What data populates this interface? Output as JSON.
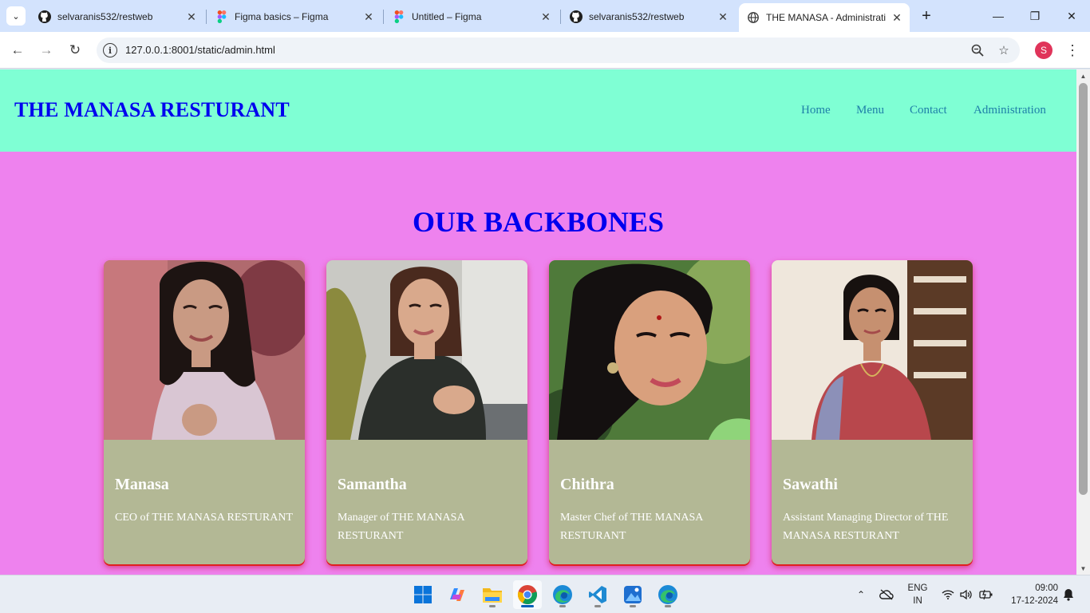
{
  "browser": {
    "tabs": [
      {
        "title": "selvaranis532/restweb",
        "icon": "github-icon"
      },
      {
        "title": "Figma basics – Figma",
        "icon": "figma-icon"
      },
      {
        "title": "Untitled – Figma",
        "icon": "figma-icon"
      },
      {
        "title": "selvaranis532/restweb",
        "icon": "github-icon"
      },
      {
        "title": "THE MANASA - Administrati",
        "icon": "globe-icon",
        "active": true
      }
    ],
    "url": "127.0.0.1:8001/static/admin.html",
    "profile_initial": "S"
  },
  "site": {
    "brand": "THE MANASA RESTURANT",
    "nav": [
      "Home",
      "Menu",
      "Contact",
      "Administration"
    ],
    "section_title": "OUR BACKBONES",
    "colors": {
      "header_bg": "#7fffd4",
      "page_bg": "#ee82ee",
      "card_bg": "#b3b895",
      "title": "#0000ee",
      "nav": "#1e7fa8"
    },
    "team": [
      {
        "name": "Manasa",
        "role": "CEO of THE MANASA RESTURANT"
      },
      {
        "name": "Samantha",
        "role": "Manager of THE MANASA RESTURANT"
      },
      {
        "name": "Chithra",
        "role": "Master Chef of THE MANASA RESTURANT"
      },
      {
        "name": "Sawathi",
        "role": "Assistant Managing Director of THE MANASA RESTURANT"
      }
    ]
  },
  "taskbar": {
    "apps": [
      "windows-start-icon",
      "copilot-icon",
      "file-explorer-icon",
      "chrome-icon",
      "edge-icon",
      "vscode-icon",
      "photos-icon",
      "edge-icon"
    ],
    "lang_line1": "ENG",
    "lang_line2": "IN",
    "time": "09:00",
    "date": "17-12-2024"
  }
}
